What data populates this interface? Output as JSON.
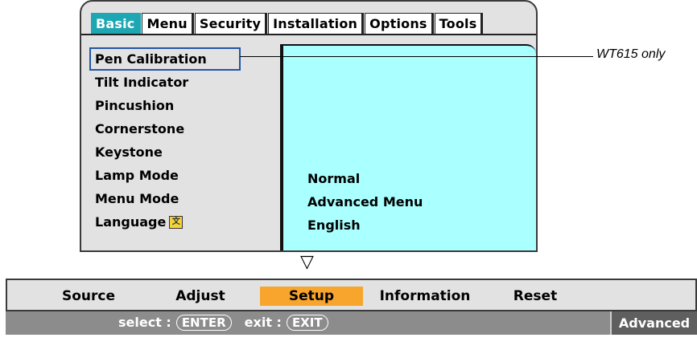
{
  "tabs": [
    {
      "label": "Basic",
      "active": true
    },
    {
      "label": "Menu",
      "active": false
    },
    {
      "label": "Security",
      "active": false
    },
    {
      "label": "Installation",
      "active": false
    },
    {
      "label": "Options",
      "active": false
    },
    {
      "label": "Tools",
      "active": false
    }
  ],
  "menu_items": [
    {
      "label": "Pen Calibration",
      "value": ""
    },
    {
      "label": "Tilt Indicator",
      "value": ""
    },
    {
      "label": "Pincushion",
      "value": ""
    },
    {
      "label": "Cornerstone",
      "value": ""
    },
    {
      "label": "Keystone",
      "value": ""
    },
    {
      "label": "Lamp Mode",
      "value": "Normal"
    },
    {
      "label": "Menu Mode",
      "value": "Advanced Menu"
    },
    {
      "label": "Language",
      "value": "English"
    }
  ],
  "selected_item": "Pen Calibration",
  "annotation": "WT615 only",
  "main_menu": [
    "Source",
    "Adjust",
    "Setup",
    "Information",
    "Reset"
  ],
  "active_main_menu": "Setup",
  "status": {
    "select_label": "select :",
    "enter_key": "ENTER",
    "exit_label": "exit :",
    "exit_key": "EXIT",
    "mode": "Advanced Menu"
  },
  "colors": {
    "active_tab": "#1ea7b3",
    "value_pane": "#aaffff",
    "active_main_menu": "#f7a52c",
    "selection_outline": "#2055a5",
    "status_bar": "#8c8c8c"
  },
  "icons": {
    "language_icon": "language-icon",
    "scroll_down": "down-triangle-icon"
  }
}
